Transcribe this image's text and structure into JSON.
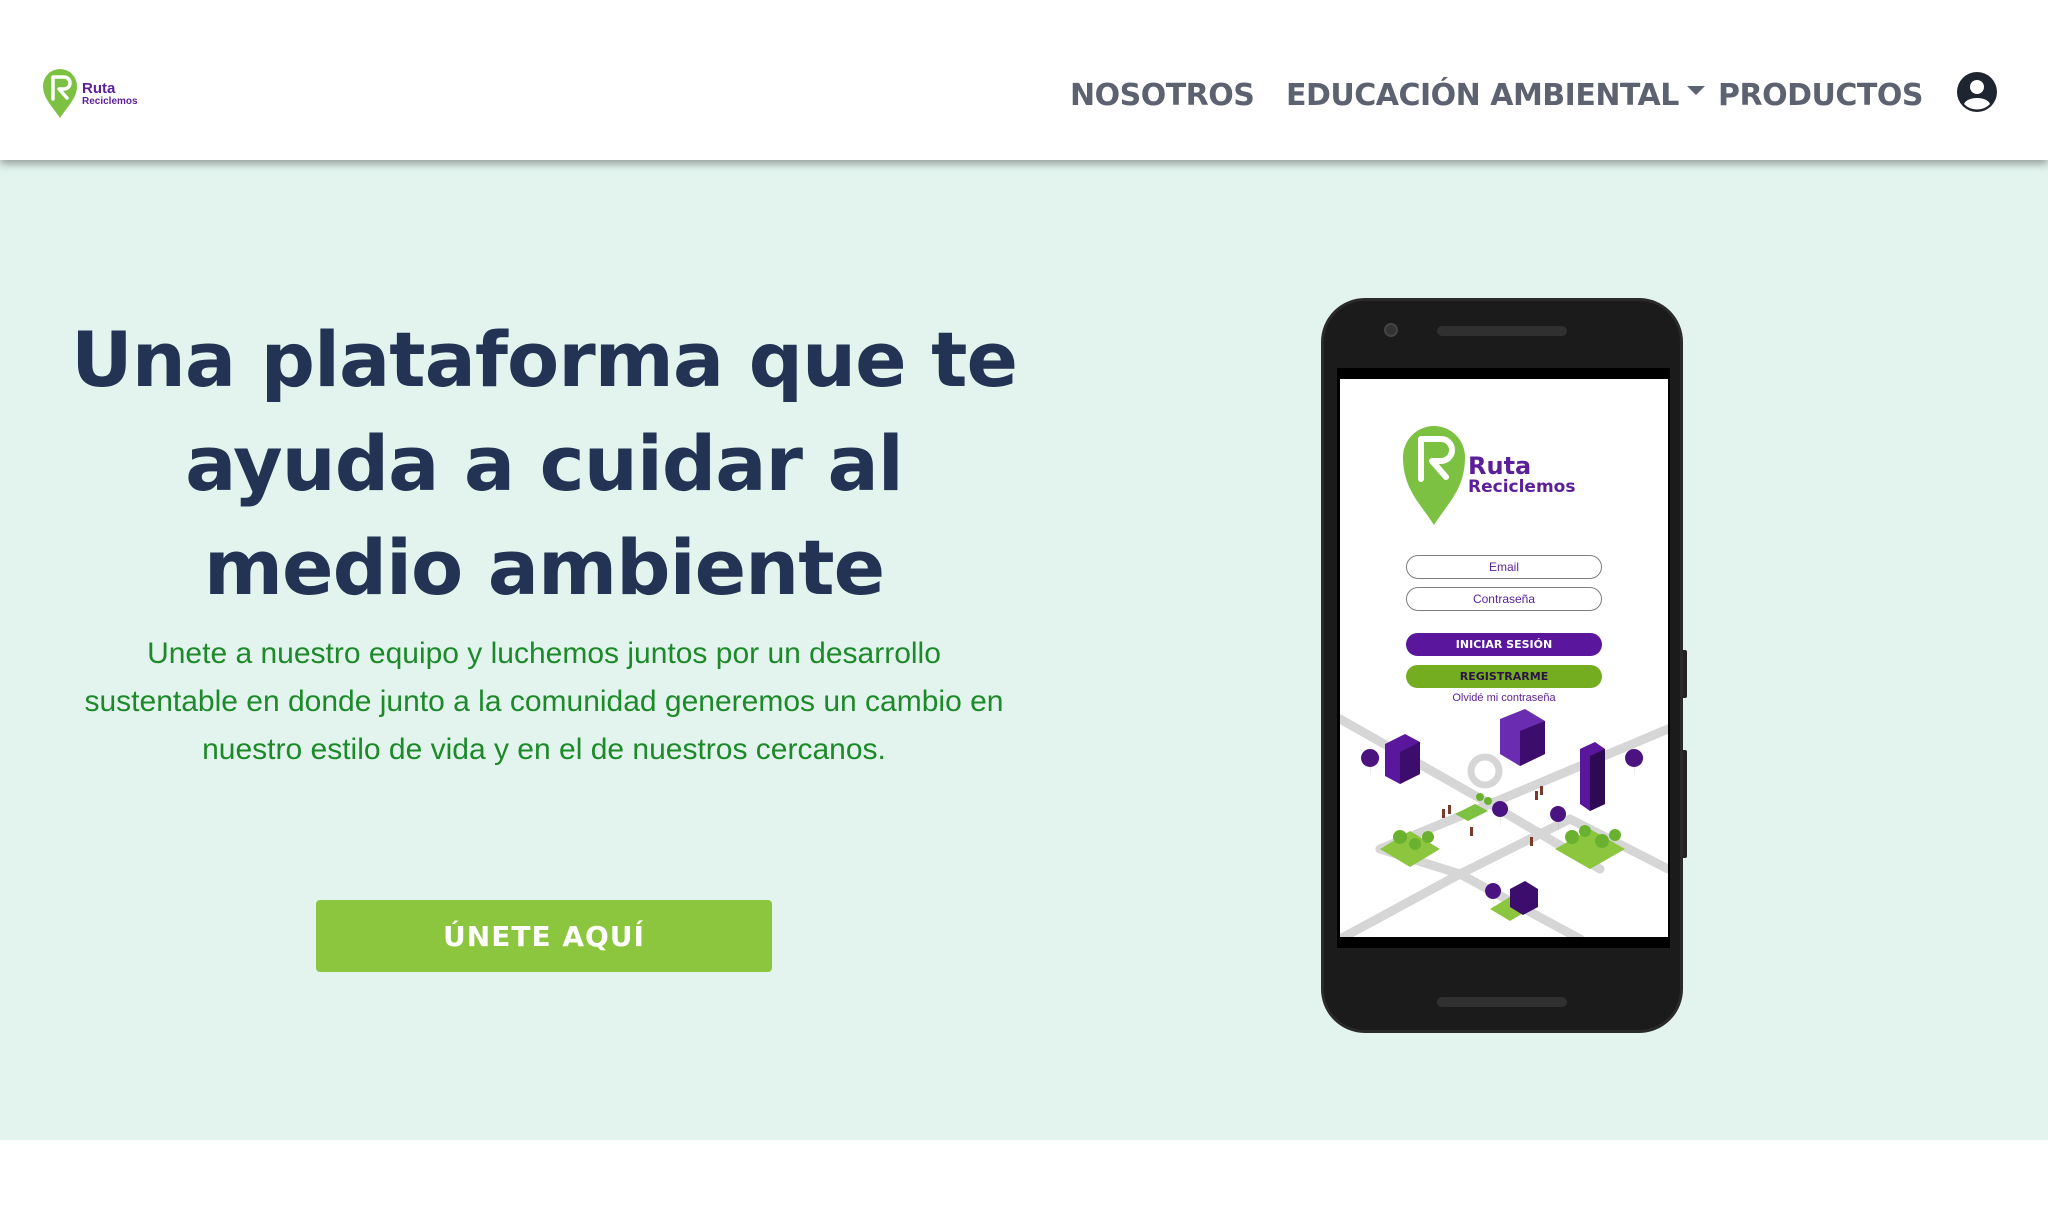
{
  "brand": {
    "name_line1": "Ruta",
    "name_line2": "Reciclemos",
    "logo_color": "#7cc142",
    "text_color": "#5b1f9a"
  },
  "nav": {
    "items": [
      {
        "label": "NOSOTROS"
      },
      {
        "label": "EDUCACIÓN AMBIENTAL",
        "has_dropdown": true
      },
      {
        "label": "PRODUCTOS"
      }
    ],
    "user_icon": "user-circle-icon"
  },
  "hero": {
    "title": "Una plataforma que te ayuda a cuidar al medio ambiente",
    "subtitle": "Unete a nuestro equipo y luchemos juntos por un desarrollo sustentable en donde junto a la comunidad generemos un cambio en nuestro estilo de vida y en el de nuestros cercanos.",
    "cta_label": "ÚNETE AQUÍ",
    "background": "#e3f4ee",
    "title_color": "#223354",
    "subtitle_color": "#1d8a2a",
    "cta_color": "#8cc63f"
  },
  "phone_app": {
    "logo_line1": "Ruta",
    "logo_line2": "Reciclemos",
    "email_placeholder": "Email",
    "password_placeholder": "Contraseña",
    "login_label": "INICIAR SESIÓN",
    "register_label": "REGISTRARME",
    "forgot_label": "Olvidé mi contraseña"
  }
}
